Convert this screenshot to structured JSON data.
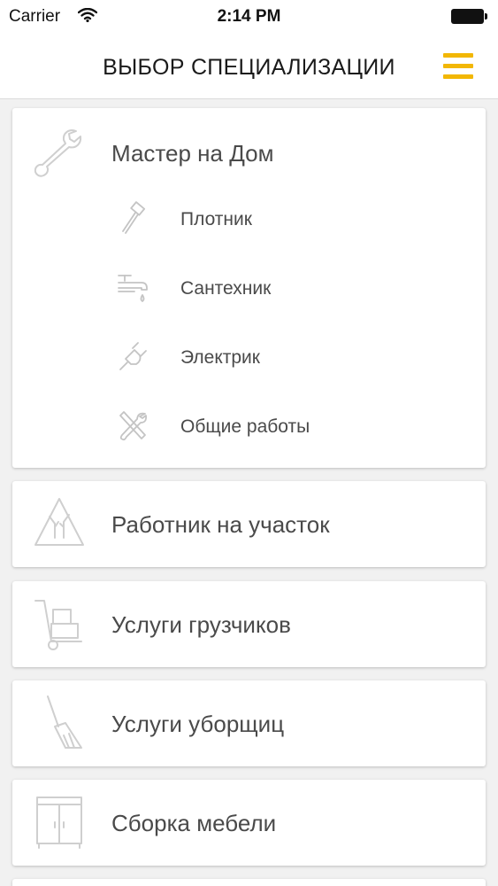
{
  "status_bar": {
    "carrier": "Carrier",
    "time": "2:14 PM",
    "wifi_icon": "wifi-icon",
    "battery_icon": "battery-icon"
  },
  "header": {
    "title": "ВЫБОР СПЕЦИАЛИЗАЦИИ",
    "menu_icon": "hamburger-menu-icon",
    "accent_color": "#f2b705"
  },
  "categories": [
    {
      "label": "Мастер на Дом",
      "icon": "wrench-icon",
      "expanded": true,
      "subitems": [
        {
          "label": "Плотник",
          "icon": "hammer-icon"
        },
        {
          "label": "Сантехник",
          "icon": "faucet-icon"
        },
        {
          "label": "Электрик",
          "icon": "plug-icon"
        },
        {
          "label": "Общие работы",
          "icon": "tools-icon"
        }
      ]
    },
    {
      "label": "Работник на участок",
      "icon": "tree-sign-icon"
    },
    {
      "label": "Услуги грузчиков",
      "icon": "hand-truck-icon"
    },
    {
      "label": "Услуги уборщиц",
      "icon": "broom-icon"
    },
    {
      "label": "Сборка мебели",
      "icon": "cabinet-icon"
    }
  ]
}
